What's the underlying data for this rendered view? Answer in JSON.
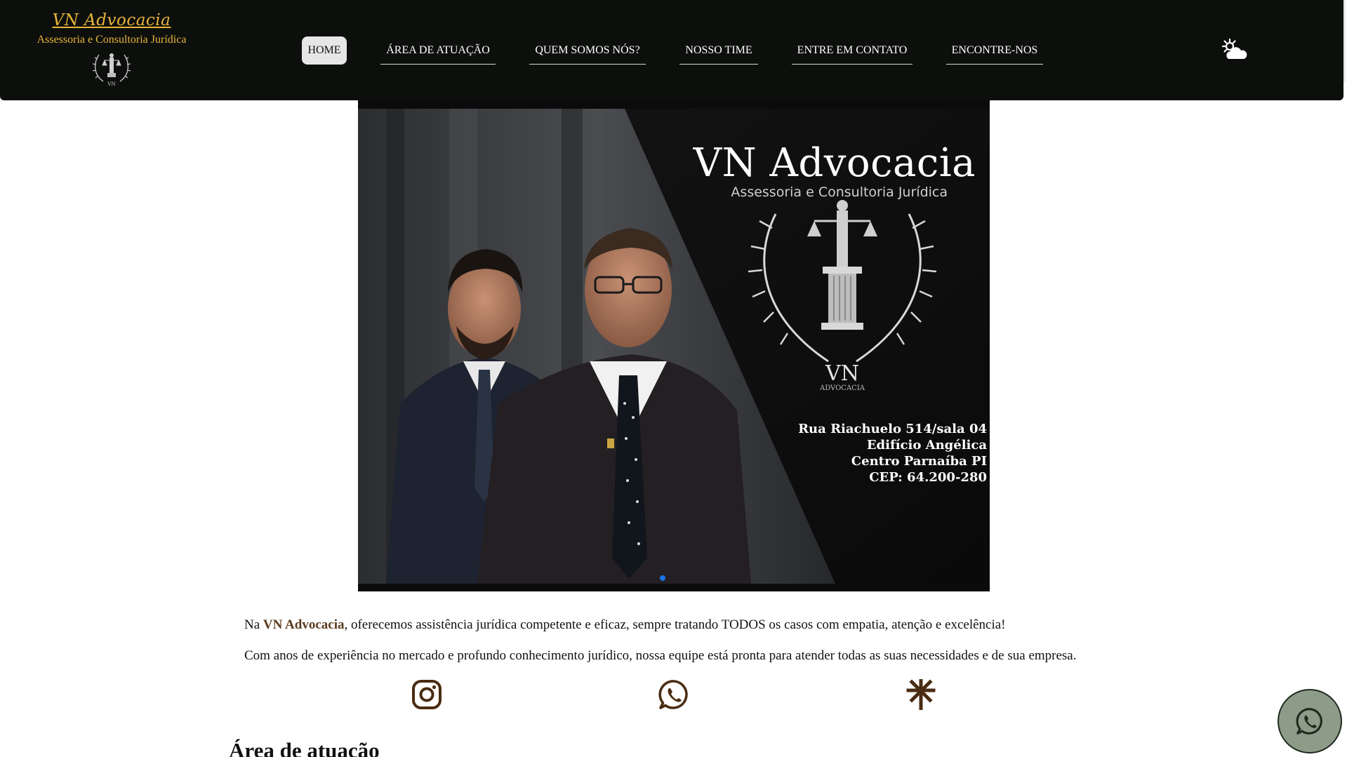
{
  "brand": {
    "name": "VN Advocacia",
    "tagline": "Assessoria e Consultoria Jurídica",
    "emblem_icon": "scales-of-justice-laurel-icon",
    "accent_color": "#e8b53a"
  },
  "nav": {
    "items": [
      {
        "label": "HOME",
        "active": true
      },
      {
        "label": "ÁREA DE ATUAÇÃO",
        "active": false
      },
      {
        "label": "QUEM SOMOS NÓS?",
        "active": false
      },
      {
        "label": "NOSSO TIME",
        "active": false
      },
      {
        "label": "ENTRE EM CONTATO",
        "active": false
      },
      {
        "label": "ENCONTRE-NOS",
        "active": false
      }
    ],
    "theme_toggle_icon": "sun-cloud-icon"
  },
  "carousel": {
    "slide": {
      "title": "VN Advocacia",
      "subtitle": "Assessoria e Consultoria Jurídica",
      "emblem_text": "VN",
      "emblem_subtext": "ADVOCACIA",
      "address": [
        "Rua Riachuelo 514/sala 04",
        "Edifício Angélica",
        "Centro Parnaíba PI",
        "CEP: 64.200-280"
      ]
    },
    "dot_color": "#1a73e8"
  },
  "intro": {
    "p1_before": "Na ",
    "p1_highlight": "VN Advocacia",
    "p1_after": ", oferecemos assistência jurídica competente e eficaz, sempre tratando TODOS os casos com empatia, atenção e excelência!",
    "p2": "Com anos de experiência no mercado e profundo conhecimento jurídico, nossa equipe está pronta para atender todas as suas necessidades e de sua empresa.",
    "highlight_color": "#5a3a1c"
  },
  "social": {
    "instagram_icon": "instagram-icon",
    "whatsapp_icon": "whatsapp-icon",
    "linktree_icon": "linktree-icon",
    "icon_color": "#4a2c12"
  },
  "section": {
    "title": "Área de atuação"
  },
  "fab": {
    "icon": "whatsapp-icon",
    "color": "#8c9c88"
  }
}
